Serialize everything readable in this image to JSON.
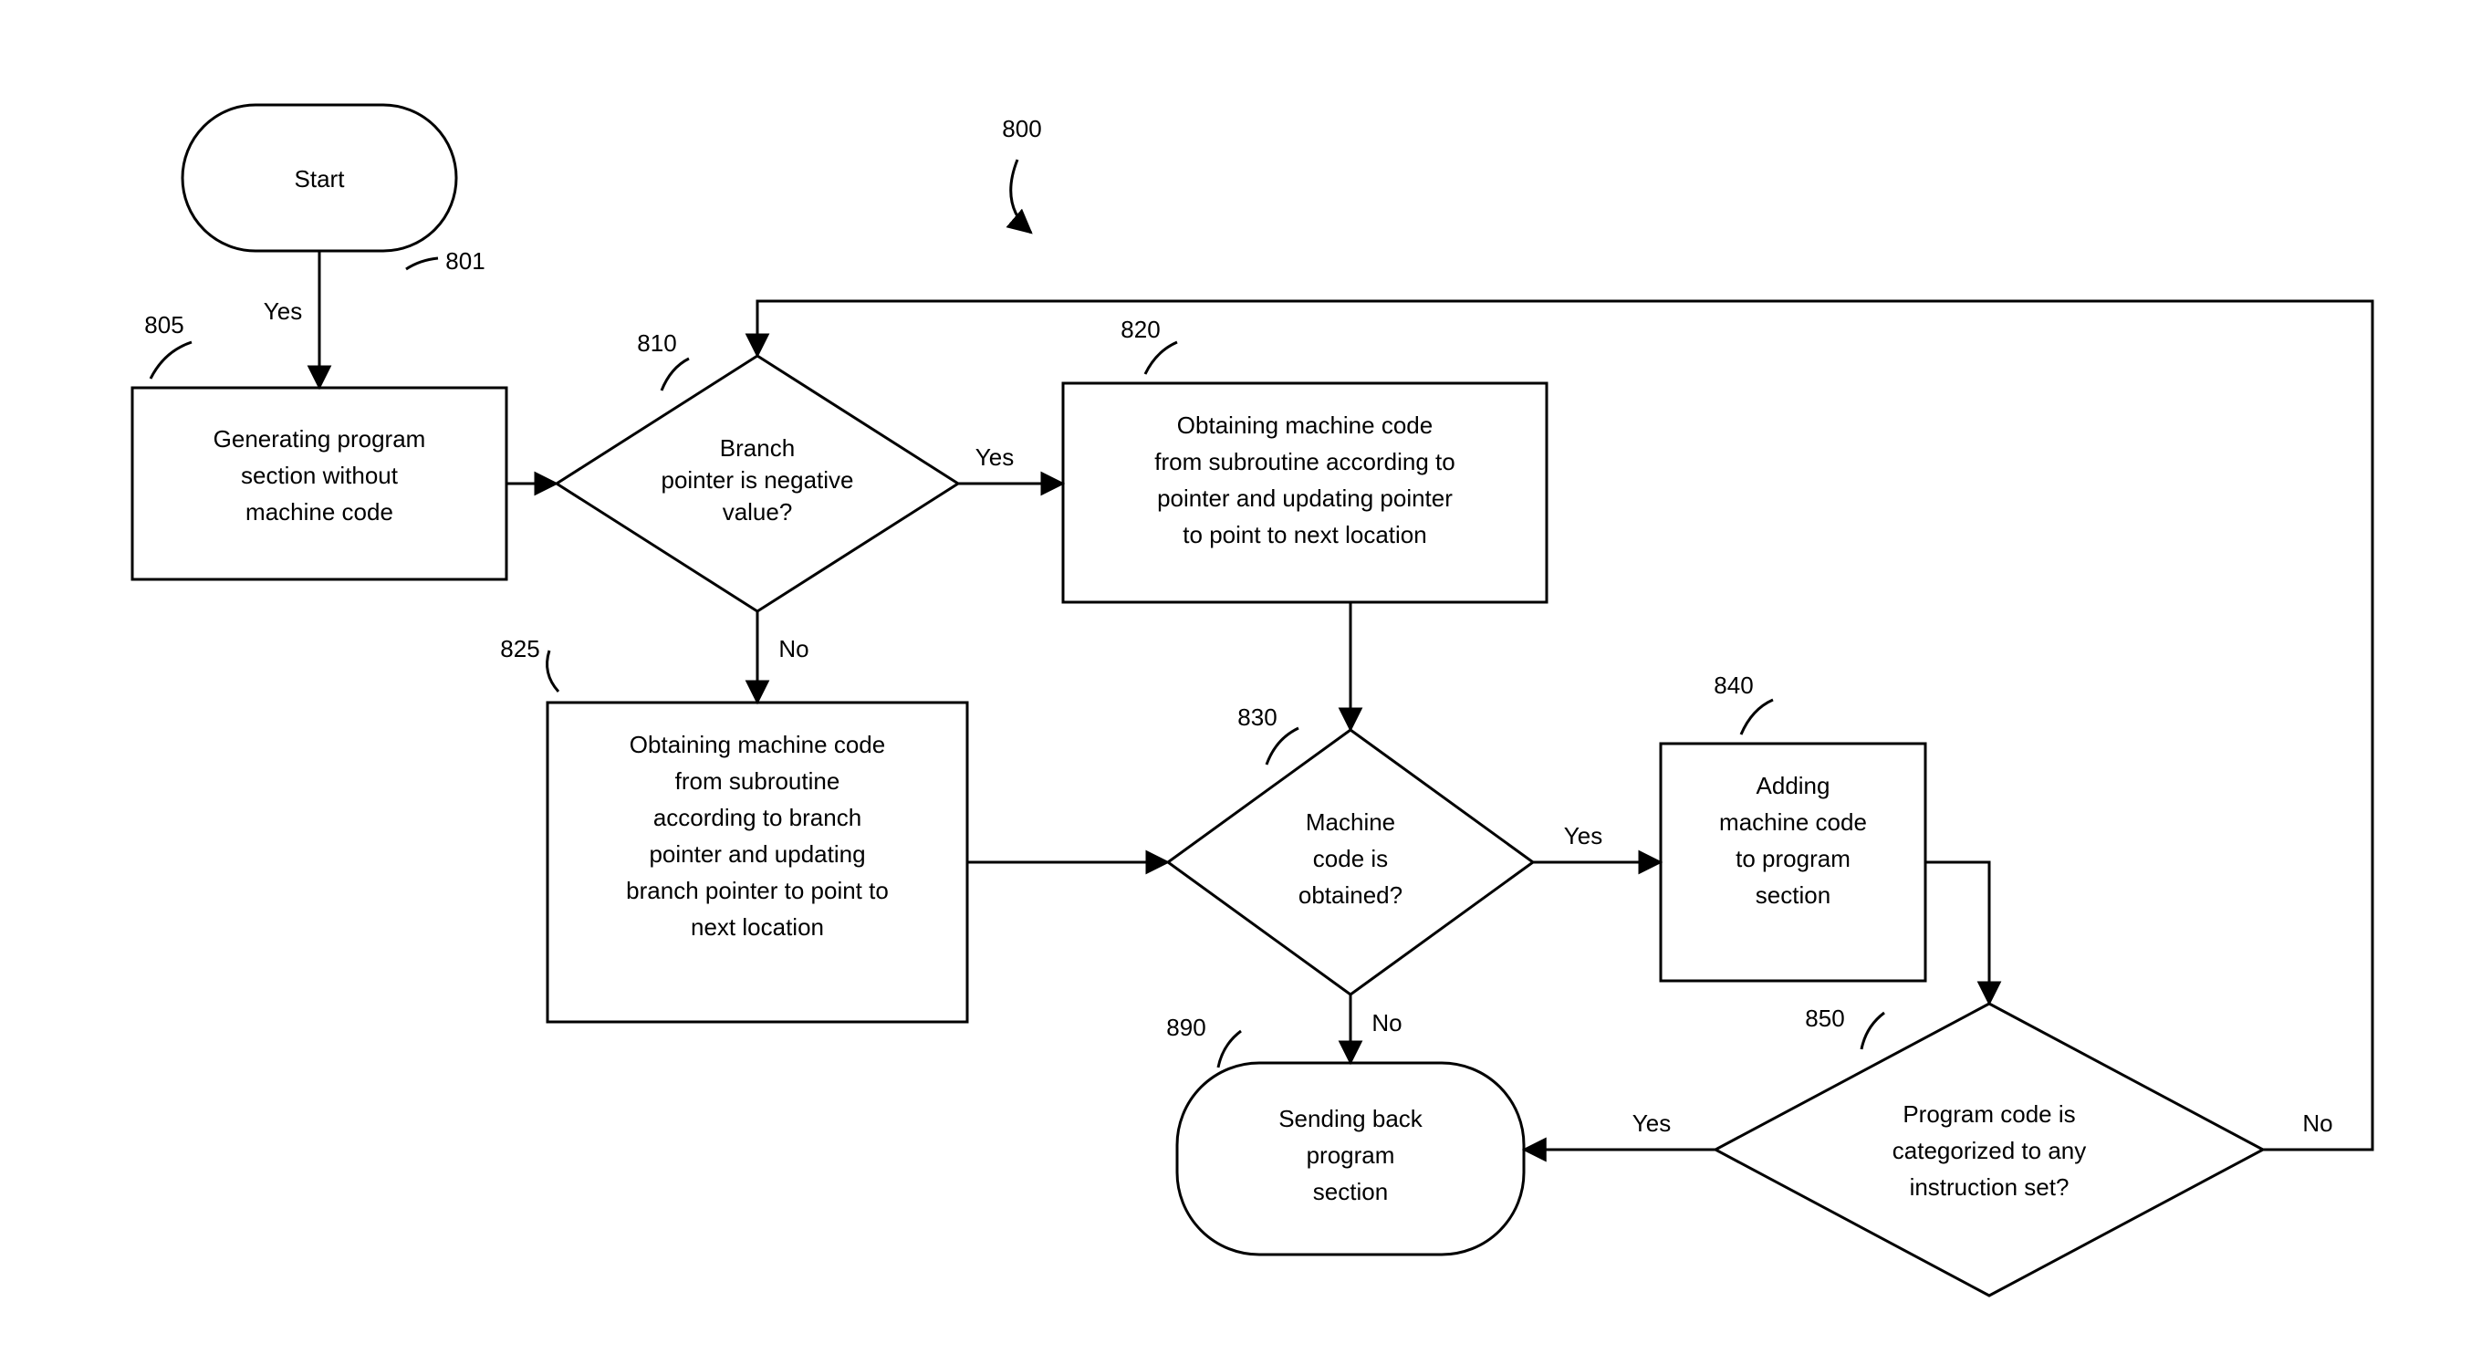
{
  "diagram_id": "800",
  "nodes": {
    "start": {
      "id": "801",
      "lines": [
        "Start"
      ]
    },
    "gen": {
      "id": "805",
      "lines": [
        "Generating program",
        "section without",
        "machine code"
      ]
    },
    "branch": {
      "id": "810",
      "lines": [
        "Branch",
        "pointer is negative",
        "value?"
      ]
    },
    "obtPtr": {
      "id": "820",
      "lines": [
        "Obtaining machine code",
        "from subroutine according to",
        "pointer and updating pointer",
        "to point to next location"
      ]
    },
    "obtBr": {
      "id": "825",
      "lines": [
        "Obtaining machine code",
        "from subroutine",
        "according to branch",
        "pointer and updating",
        "branch pointer to point to",
        "next location"
      ]
    },
    "isObt": {
      "id": "830",
      "lines": [
        "Machine",
        "code is",
        "obtained?"
      ]
    },
    "add": {
      "id": "840",
      "lines": [
        "Adding",
        "machine code",
        "to program",
        "section"
      ]
    },
    "isCat": {
      "id": "850",
      "lines": [
        "Program code is",
        "categorized to any",
        "instruction set?"
      ]
    },
    "send": {
      "id": "890",
      "lines": [
        "Sending back",
        "program",
        "section"
      ]
    }
  },
  "edges": {
    "start_gen": "Yes",
    "branch_yes": "Yes",
    "branch_no": "No",
    "isObt_yes": "Yes",
    "isObt_no": "No",
    "isCat_yes": "Yes",
    "isCat_no": "No"
  }
}
